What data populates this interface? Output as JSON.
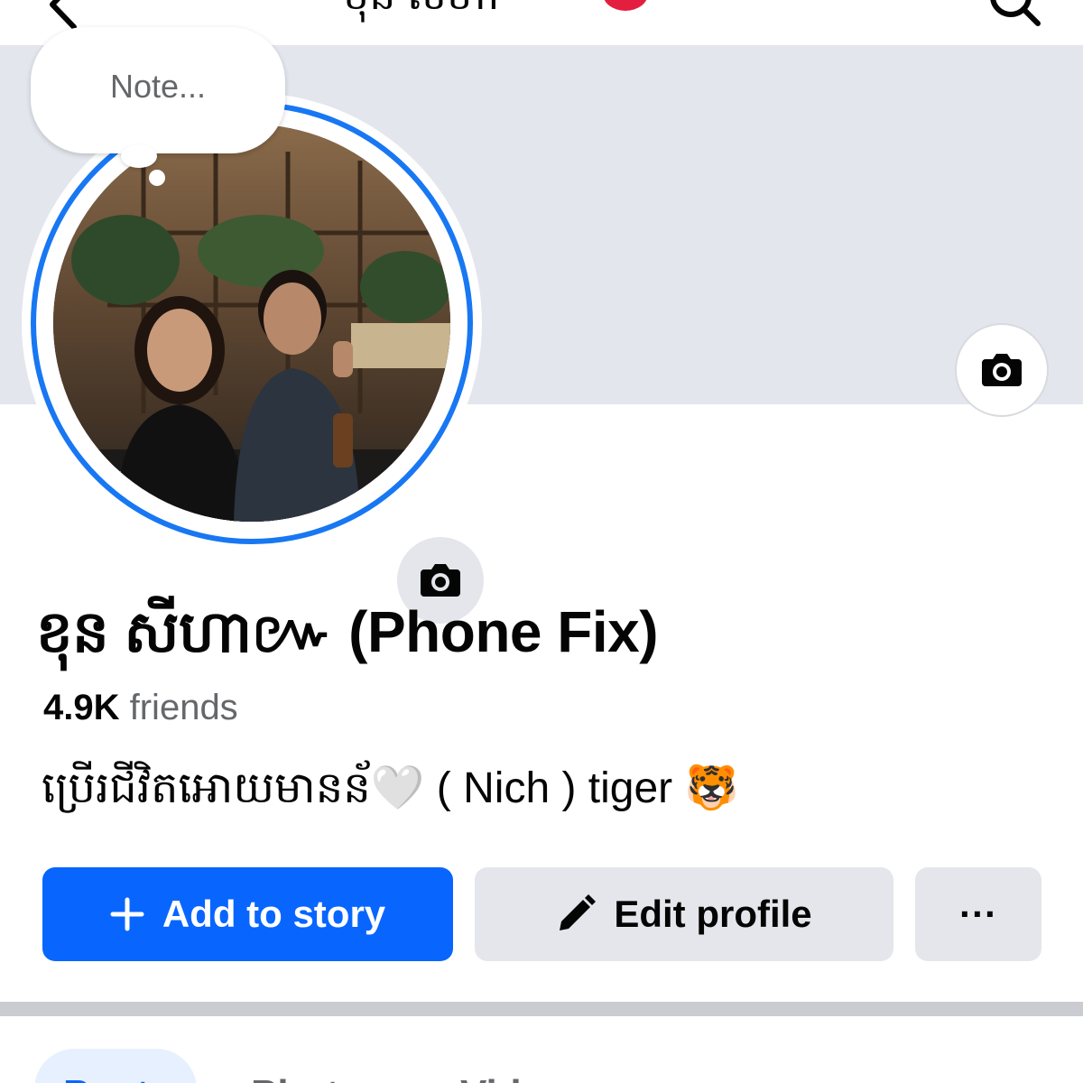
{
  "header": {
    "title": "ខុន សីហា",
    "back_icon": "arrow-left-icon",
    "search_icon": "search-icon"
  },
  "note": {
    "placeholder": "Note..."
  },
  "profile": {
    "name": "ខុន សីហា៚ (Phone Fix)",
    "friends_count": "4.9K",
    "friends_label": "friends",
    "bio": "ប្រើរជីវិតអោយមានន័🤍  ( Nich ) tiger 🐯"
  },
  "actions": {
    "add_story": "Add to story",
    "edit_profile": "Edit profile",
    "more": "···"
  },
  "tabs": [
    {
      "label": "Posts"
    },
    {
      "label": "Photos"
    },
    {
      "label": "Videos"
    }
  ],
  "colors": {
    "primary": "#0866ff",
    "ring": "#1877f2",
    "cover": "#e4e6ee",
    "button_secondary": "#e4e6eb",
    "badge": "#e41e3f"
  }
}
